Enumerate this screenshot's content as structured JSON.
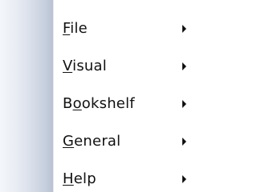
{
  "menu": {
    "items": [
      {
        "label": "File",
        "mnemonic_index": 0,
        "has_submenu": true,
        "arrow_icon": "submenu-arrow-icon"
      },
      {
        "label": "Visual",
        "mnemonic_index": 0,
        "has_submenu": true,
        "arrow_icon": "submenu-arrow-icon"
      },
      {
        "label": "Bookshelf",
        "mnemonic_index": 1,
        "has_submenu": true,
        "arrow_icon": "submenu-arrow-icon"
      },
      {
        "label": "General",
        "mnemonic_index": 0,
        "has_submenu": true,
        "arrow_icon": "submenu-arrow-icon"
      },
      {
        "label": "Help",
        "mnemonic_index": 0,
        "has_submenu": true,
        "arrow_icon": "submenu-arrow-icon"
      }
    ]
  }
}
